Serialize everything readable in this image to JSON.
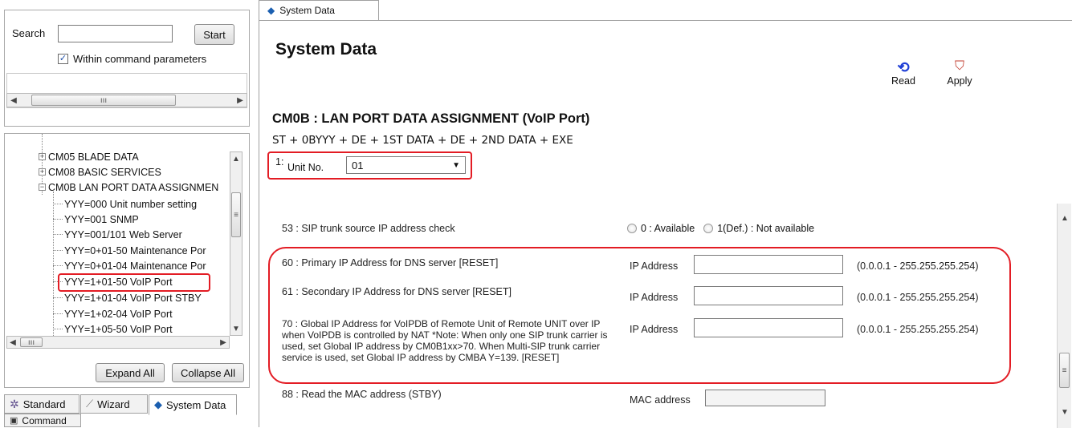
{
  "search": {
    "label": "Search",
    "value": "",
    "start_button": "Start",
    "within_label": "Within command parameters",
    "within_checked": true
  },
  "tree": {
    "items": [
      {
        "label": "CM05 BLADE DATA",
        "type": "folder-collapsed"
      },
      {
        "label": "CM08 BASIC SERVICES",
        "type": "folder-collapsed"
      },
      {
        "label": "CM0B LAN PORT DATA ASSIGNMEN",
        "type": "folder-expanded"
      },
      {
        "label": "YYY=000 Unit number setting",
        "type": "leaf"
      },
      {
        "label": "YYY=001 SNMP",
        "type": "leaf"
      },
      {
        "label": "YYY=001/101 Web Server",
        "type": "leaf"
      },
      {
        "label": "YYY=0+01-50 Maintenance Por",
        "type": "leaf"
      },
      {
        "label": "YYY=0+01-04 Maintenance Por",
        "type": "leaf"
      },
      {
        "label": "YYY=1+01-50 VoIP Port",
        "type": "leaf",
        "selected": true
      },
      {
        "label": "YYY=1+01-04 VoIP Port STBY",
        "type": "leaf"
      },
      {
        "label": "YYY=1+02-04 VoIP Port",
        "type": "leaf"
      },
      {
        "label": "YYY=1+05-50 VoIP Port",
        "type": "leaf"
      }
    ],
    "expand_all": "Expand All",
    "collapse_all": "Collapse All"
  },
  "bottom_tabs": {
    "standard": "Standard",
    "wizard": "Wizard",
    "system_data": "System Data",
    "command": "Command"
  },
  "main": {
    "tab_label": "System Data",
    "page_title": "System Data",
    "read_label": "Read",
    "apply_label": "Apply",
    "section_title": "CM0B : LAN PORT DATA ASSIGNMENT (VoIP Port)",
    "command_format": "ST + 0BYYY + DE + 1ST DATA + DE + 2ND DATA + EXE",
    "param_index": "1:",
    "unit_label": "Unit No.",
    "unit_value": "01",
    "rows": [
      {
        "label": "53 : SIP trunk source IP address check",
        "opt1": "0 : Available",
        "opt2": "1(Def.) : Not available"
      },
      {
        "label": "60 : Primary IP Address for DNS server [RESET]",
        "field_label": "IP Address",
        "value": "",
        "range": "(0.0.0.1 - 255.255.255.254)"
      },
      {
        "label": "61 : Secondary IP Address for DNS server [RESET]",
        "field_label": "IP Address",
        "value": "",
        "range": "(0.0.0.1 - 255.255.255.254)"
      },
      {
        "label": "70 : Global IP Address for VoIPDB of Remote Unit of Remote UNIT over IP when VoIPDB is controlled by NAT          *Note: When only one SIP trunk carrier is used, set Global IP address by CM0B1xx>70.  When Multi-SIP trunk carrier service is used, set Global IP address by CMBA Y=139. [RESET]",
        "field_label": "IP Address",
        "value": "",
        "range": "(0.0.0.1 - 255.255.255.254)"
      },
      {
        "label": "88 : Read the MAC address (STBY)",
        "field_label": "MAC address",
        "value": ""
      }
    ]
  },
  "colors": {
    "highlight": "#e31c24",
    "read_icon": "#1f3fd6",
    "apply_icon": "#c0392b"
  }
}
